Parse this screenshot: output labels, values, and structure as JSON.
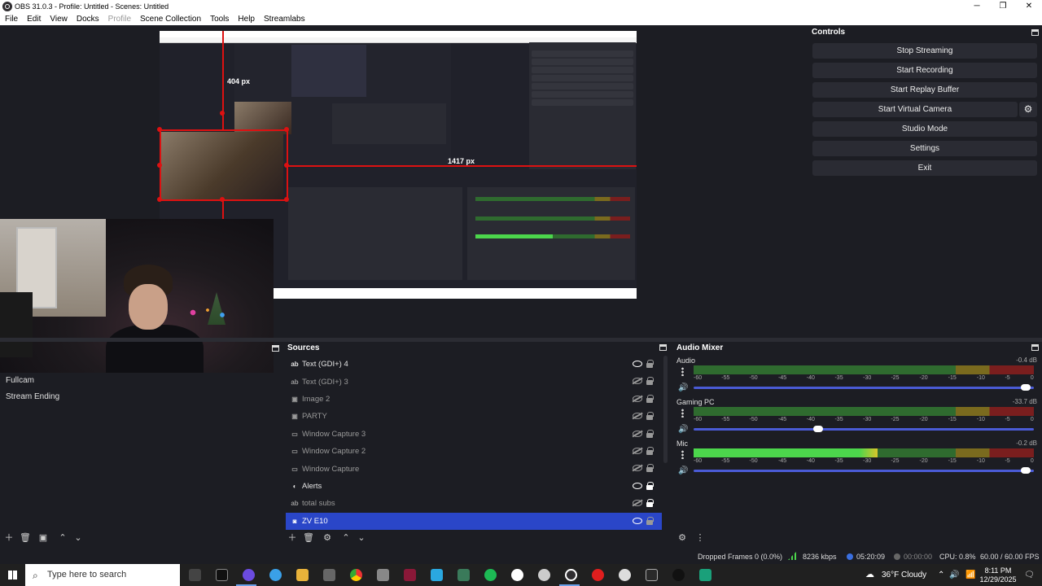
{
  "window": {
    "title": "OBS 31.0.3 - Profile: Untitled - Scenes: Untitled",
    "minimize": "─",
    "maximize": "❐",
    "close": "✕"
  },
  "menu": [
    "File",
    "Edit",
    "View",
    "Docks",
    "Profile",
    "Scene Collection",
    "Tools",
    "Help",
    "Streamlabs"
  ],
  "preview": {
    "measure_vertical": "404 px",
    "measure_horizontal": "1417 px"
  },
  "scenes": {
    "items": [
      "Fullcam",
      "Stream Ending"
    ]
  },
  "sources": {
    "title": "Sources",
    "items": [
      {
        "label": "Text (GDI+) 4",
        "icon": "text-icon",
        "glyph": "ab",
        "visible": true,
        "locked": false,
        "selected": false
      },
      {
        "label": "Text (GDI+) 3",
        "icon": "text-icon",
        "glyph": "ab",
        "visible": false,
        "locked": false,
        "selected": false
      },
      {
        "label": "Image 2",
        "icon": "image-icon",
        "glyph": "▣",
        "visible": false,
        "locked": false,
        "selected": false
      },
      {
        "label": "PARTY",
        "icon": "image-icon",
        "glyph": "▣",
        "visible": false,
        "locked": false,
        "selected": false
      },
      {
        "label": "Window Capture 3",
        "icon": "window-icon",
        "glyph": "▭",
        "visible": false,
        "locked": false,
        "selected": false
      },
      {
        "label": "Window Capture 2",
        "icon": "window-icon",
        "glyph": "▭",
        "visible": false,
        "locked": false,
        "selected": false
      },
      {
        "label": "Window Capture",
        "icon": "window-icon",
        "glyph": "▭",
        "visible": false,
        "locked": false,
        "selected": false
      },
      {
        "label": "Alerts",
        "icon": "browser-icon",
        "glyph": "◐",
        "visible": true,
        "locked": true,
        "selected": false
      },
      {
        "label": "total subs",
        "icon": "text-icon",
        "glyph": "ab",
        "visible": false,
        "locked": true,
        "selected": false
      },
      {
        "label": "ZV E10",
        "icon": "camera-icon",
        "glyph": "◙",
        "visible": true,
        "locked": false,
        "selected": true
      }
    ]
  },
  "mixer": {
    "title": "Audio Mixer",
    "ticks": [
      "-60",
      "-55",
      "-50",
      "-45",
      "-40",
      "-35",
      "-30",
      "-25",
      "-20",
      "-15",
      "-10",
      "-5",
      "0"
    ],
    "channels": [
      {
        "name": "Audio",
        "db": "-0.4 dB",
        "level": 0.0,
        "volume": 0.99
      },
      {
        "name": "Gaming PC",
        "db": "-33.7 dB",
        "level": 0.0,
        "volume": 0.38
      },
      {
        "name": "Mic",
        "db": "-0.2 dB",
        "level": 0.54,
        "volume": 0.99
      }
    ]
  },
  "controls": {
    "title": "Controls",
    "buttons": [
      "Stop Streaming",
      "Start Recording",
      "Start Replay Buffer",
      "Start Virtual Camera",
      "Studio Mode",
      "Settings",
      "Exit"
    ]
  },
  "status": {
    "dropped": "Dropped Frames 0 (0.0%)",
    "bitrate": "8236 kbps",
    "stream_time": "05:20:09",
    "rec_time": "00:00:00",
    "cpu": "CPU: 0.8%",
    "fps": "60.00 / 60.00 FPS"
  },
  "taskbar": {
    "search_placeholder": "Type here to search",
    "weather": "36°F  Cloudy",
    "time": "8:11 PM",
    "date": "12/29/2025"
  },
  "colors": {
    "accent": "#2a46c8",
    "meter_green": "#4cd64c",
    "meter_yellow": "#d8c62a",
    "meter_red": "#7a1e1e",
    "guide_red": "#d11111"
  }
}
